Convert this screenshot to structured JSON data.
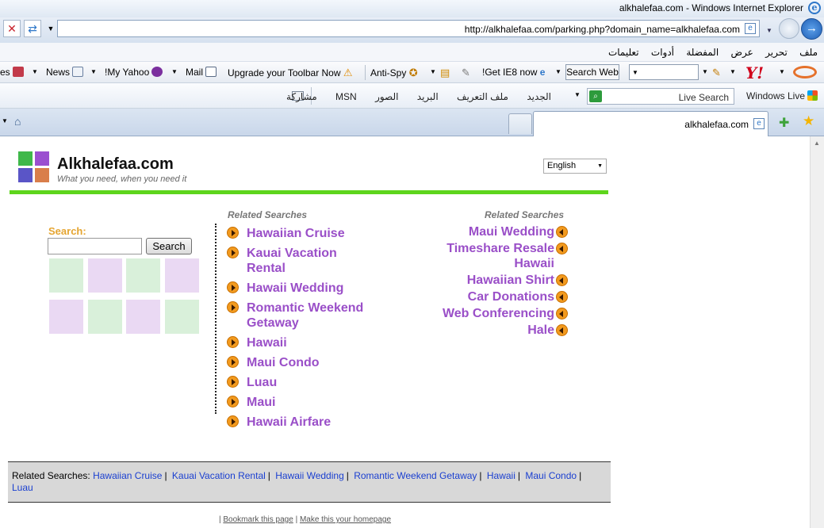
{
  "window": {
    "title": "alkhalefaa.com - Windows Internet Explorer",
    "url": "http://alkhalefaa.com/parking.php?domain_name=alkhalefaa.com"
  },
  "menu": [
    "ملف",
    "تحرير",
    "عرض",
    "المفضلة",
    "أدوات",
    "تعليمات"
  ],
  "yahoo_toolbar": {
    "games": "es",
    "news": "News",
    "my_yahoo": "!My Yahoo",
    "mail": "Mail",
    "upgrade": "Upgrade your Toolbar Now",
    "antispy": "Anti-Spy",
    "get_ie8": "!Get IE8 now",
    "search_web": "Search Web"
  },
  "live_toolbar": {
    "brand": "Windows Live",
    "search_placeholder": "Live Search",
    "links": [
      "الجديد",
      "ملف التعريف",
      "البريد",
      "الصور",
      "MSN",
      "مشاركة"
    ]
  },
  "tab": {
    "label": "alkhalefaa.com"
  },
  "site": {
    "title": "Alkhalefaa.com",
    "tagline": "What you need, when you need it",
    "language": "English"
  },
  "search": {
    "label": "Search:",
    "button": "Search"
  },
  "tiles": {
    "green": "#d9f0da",
    "purple": "#ead9f3"
  },
  "left_related": {
    "heading": "Related Searches",
    "items": [
      "Hawaiian Cruise",
      "Kauai Vacation Rental",
      "Hawaii Wedding",
      "Romantic Weekend Getaway",
      "Hawaii",
      "Maui Condo",
      "Luau",
      "Maui",
      "Hawaii Airfare"
    ]
  },
  "right_related": {
    "heading": "Related Searches",
    "items": [
      "Maui Wedding",
      "Timeshare Resale Hawaii",
      "Hawaiian Shirt",
      "Car Donations",
      "Web Conferencing",
      "Hale"
    ]
  },
  "bottom_bar": {
    "label": "Related Searches:",
    "links": [
      "Hawaiian Cruise",
      "Kauai Vacation Rental",
      "Hawaii Wedding",
      "Romantic Weekend Getaway",
      "Hawaii",
      "Maui Condo",
      "Luau"
    ]
  },
  "footer": {
    "bookmark": "Bookmark this page",
    "homepage": "Make this your homepage"
  },
  "colors": {
    "link_purple": "#9a4fc8",
    "search_orange": "#e5a531",
    "rule_green": "#5ed51c",
    "bottom_link_blue": "#1a3fd0"
  }
}
